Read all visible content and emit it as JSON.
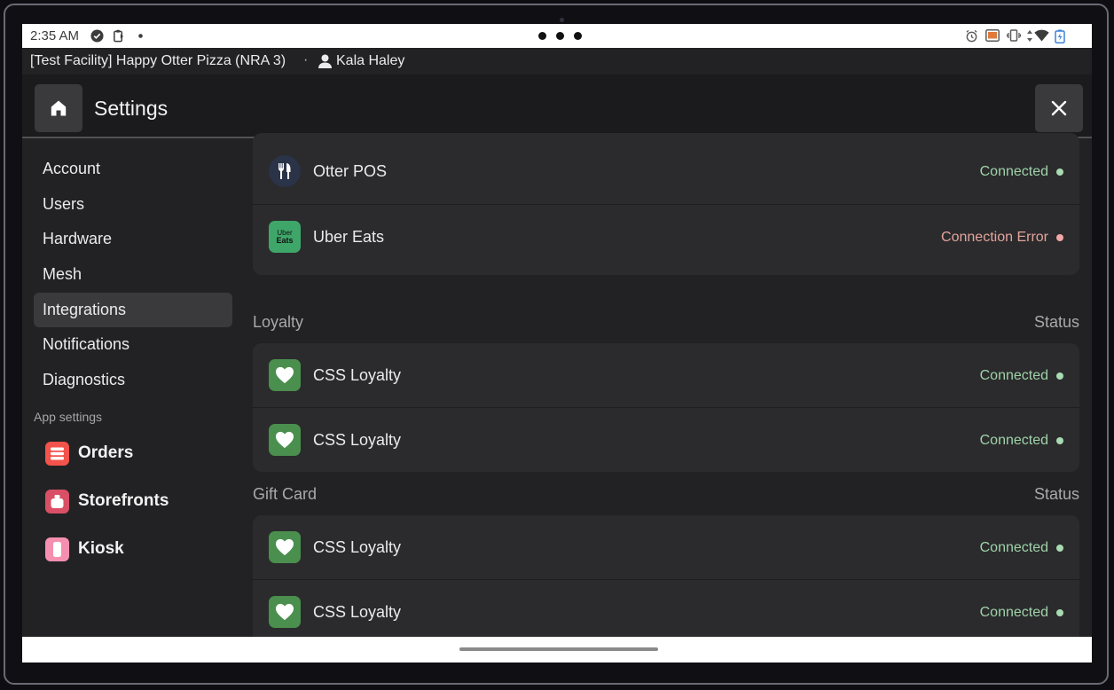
{
  "status_bar": {
    "time": "2:35 AM",
    "left_icons": [
      "check-circle-icon",
      "clipboard-icon",
      "dot-icon"
    ],
    "right_icons": [
      "alarm-icon",
      "cast-icon",
      "vibrate-icon",
      "data-arrows-icon",
      "wifi-icon",
      "battery-icon"
    ]
  },
  "facility_bar": {
    "facility": "[Test Facility] Happy Otter Pizza (NRA 3)",
    "separator": "·",
    "user_name": "Kala Haley"
  },
  "header": {
    "title": "Settings",
    "home_icon": "home-icon",
    "close_icon": "close-icon"
  },
  "sidebar": {
    "items": [
      {
        "label": "Account",
        "active": false
      },
      {
        "label": "Users",
        "active": false
      },
      {
        "label": "Hardware",
        "active": false
      },
      {
        "label": "Mesh",
        "active": false
      },
      {
        "label": "Integrations",
        "active": true
      },
      {
        "label": "Notifications",
        "active": false
      },
      {
        "label": "Diagnostics",
        "active": false
      }
    ],
    "app_settings_label": "App settings",
    "apps": [
      {
        "label": "Orders",
        "icon": "orders-icon",
        "color": "#f2534a"
      },
      {
        "label": "Storefronts",
        "icon": "storefront-icon",
        "color": "#d94f66"
      },
      {
        "label": "Kiosk",
        "icon": "kiosk-icon",
        "color": "#f58fb0"
      }
    ]
  },
  "content": {
    "pos_rows": [
      {
        "name": "Otter POS",
        "icon": "fork-knife-icon",
        "status": "Connected",
        "state": "ok"
      },
      {
        "name": "Uber Eats",
        "icon": "uber-eats-logo",
        "icon_text": [
          "Uber",
          "Eats"
        ],
        "status": "Connection Error",
        "state": "error"
      }
    ],
    "loyalty": {
      "title": "Loyalty",
      "status_header": "Status",
      "rows": [
        {
          "name": "CSS Loyalty",
          "icon": "heart-icon",
          "status": "Connected",
          "state": "ok"
        },
        {
          "name": "CSS Loyalty",
          "icon": "heart-icon",
          "status": "Connected",
          "state": "ok"
        }
      ]
    },
    "gift_card": {
      "title": "Gift Card",
      "status_header": "Status",
      "rows": [
        {
          "name": "CSS Loyalty",
          "icon": "heart-icon",
          "status": "Connected",
          "state": "ok"
        },
        {
          "name": "CSS Loyalty",
          "icon": "heart-icon",
          "status": "Connected",
          "state": "ok"
        }
      ]
    }
  },
  "colors": {
    "connected": "#9fd3a9",
    "error": "#e4a39c",
    "loyalty_icon_bg": "#4a8f4e",
    "uber_icon_bg": "#3fa66a",
    "otter_icon_bg": "#2a3347"
  }
}
